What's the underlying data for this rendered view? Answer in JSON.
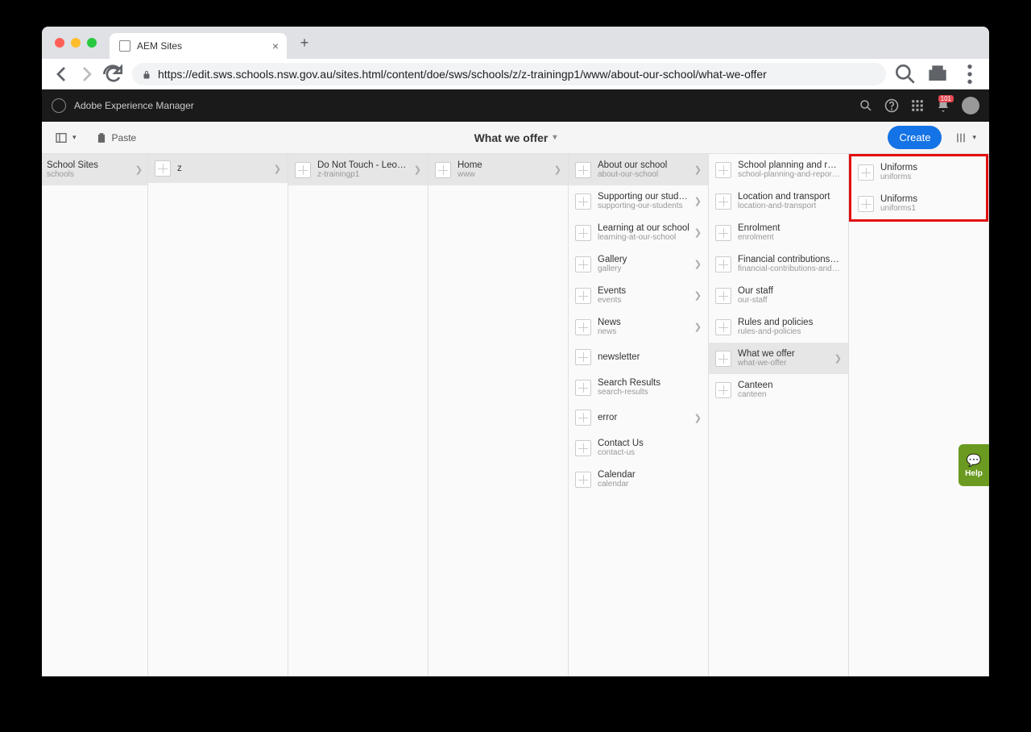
{
  "browser": {
    "tab_title": "AEM Sites",
    "url": "https://edit.sws.schools.nsw.gov.au/sites.html/content/doe/sws/schools/z/z-trainingp1/www/about-our-school/what-we-offer"
  },
  "aem_header": {
    "brand": "Adobe Experience Manager",
    "notification_count": "101"
  },
  "toolbar": {
    "paste_label": "Paste",
    "breadcrumb": "What we offer",
    "create_label": "Create"
  },
  "columns": [
    {
      "items": [
        {
          "title": "School Sites",
          "path": "schools",
          "has_children": true,
          "selected": true
        }
      ]
    },
    {
      "items": [
        {
          "title": "z",
          "path": "",
          "has_children": true,
          "selected": true
        }
      ]
    },
    {
      "items": [
        {
          "title": "Do Not Touch - Leon - ...",
          "path": "z-trainingp1",
          "has_children": true,
          "selected": true
        }
      ]
    },
    {
      "items": [
        {
          "title": "Home",
          "path": "www",
          "has_children": true,
          "selected": true
        }
      ]
    },
    {
      "items": [
        {
          "title": "About our school",
          "path": "about-our-school",
          "has_children": true,
          "selected": true
        },
        {
          "title": "Supporting our students",
          "path": "supporting-our-students",
          "has_children": true
        },
        {
          "title": "Learning at our school",
          "path": "learning-at-our-school",
          "has_children": true
        },
        {
          "title": "Gallery",
          "path": "gallery",
          "has_children": true
        },
        {
          "title": "Events",
          "path": "events",
          "has_children": true
        },
        {
          "title": "News",
          "path": "news",
          "has_children": true
        },
        {
          "title": "newsletter",
          "path": "",
          "has_children": false
        },
        {
          "title": "Search Results",
          "path": "search-results",
          "has_children": false
        },
        {
          "title": "error",
          "path": "",
          "has_children": true
        },
        {
          "title": "Contact Us",
          "path": "contact-us",
          "has_children": false
        },
        {
          "title": "Calendar",
          "path": "calendar",
          "has_children": false
        }
      ]
    },
    {
      "items": [
        {
          "title": "School planning and reporting",
          "path": "school-planning-and-reporting",
          "has_children": false
        },
        {
          "title": "Location and transport",
          "path": "location-and-transport",
          "has_children": false
        },
        {
          "title": "Enrolment",
          "path": "enrolment",
          "has_children": false
        },
        {
          "title": "Financial contributions and as...",
          "path": "financial-contributions-and-as...",
          "has_children": false
        },
        {
          "title": "Our staff",
          "path": "our-staff",
          "has_children": false
        },
        {
          "title": "Rules and policies",
          "path": "rules-and-policies",
          "has_children": false
        },
        {
          "title": "What we offer",
          "path": "what-we-offer",
          "has_children": true,
          "selected": true
        },
        {
          "title": "Canteen",
          "path": "canteen",
          "has_children": false
        }
      ]
    },
    {
      "highlight": true,
      "items": [
        {
          "title": "Uniforms",
          "path": "uniforms",
          "has_children": false
        },
        {
          "title": "Uniforms",
          "path": "uniforms1",
          "has_children": false
        }
      ]
    }
  ],
  "help": {
    "label": "Help"
  }
}
